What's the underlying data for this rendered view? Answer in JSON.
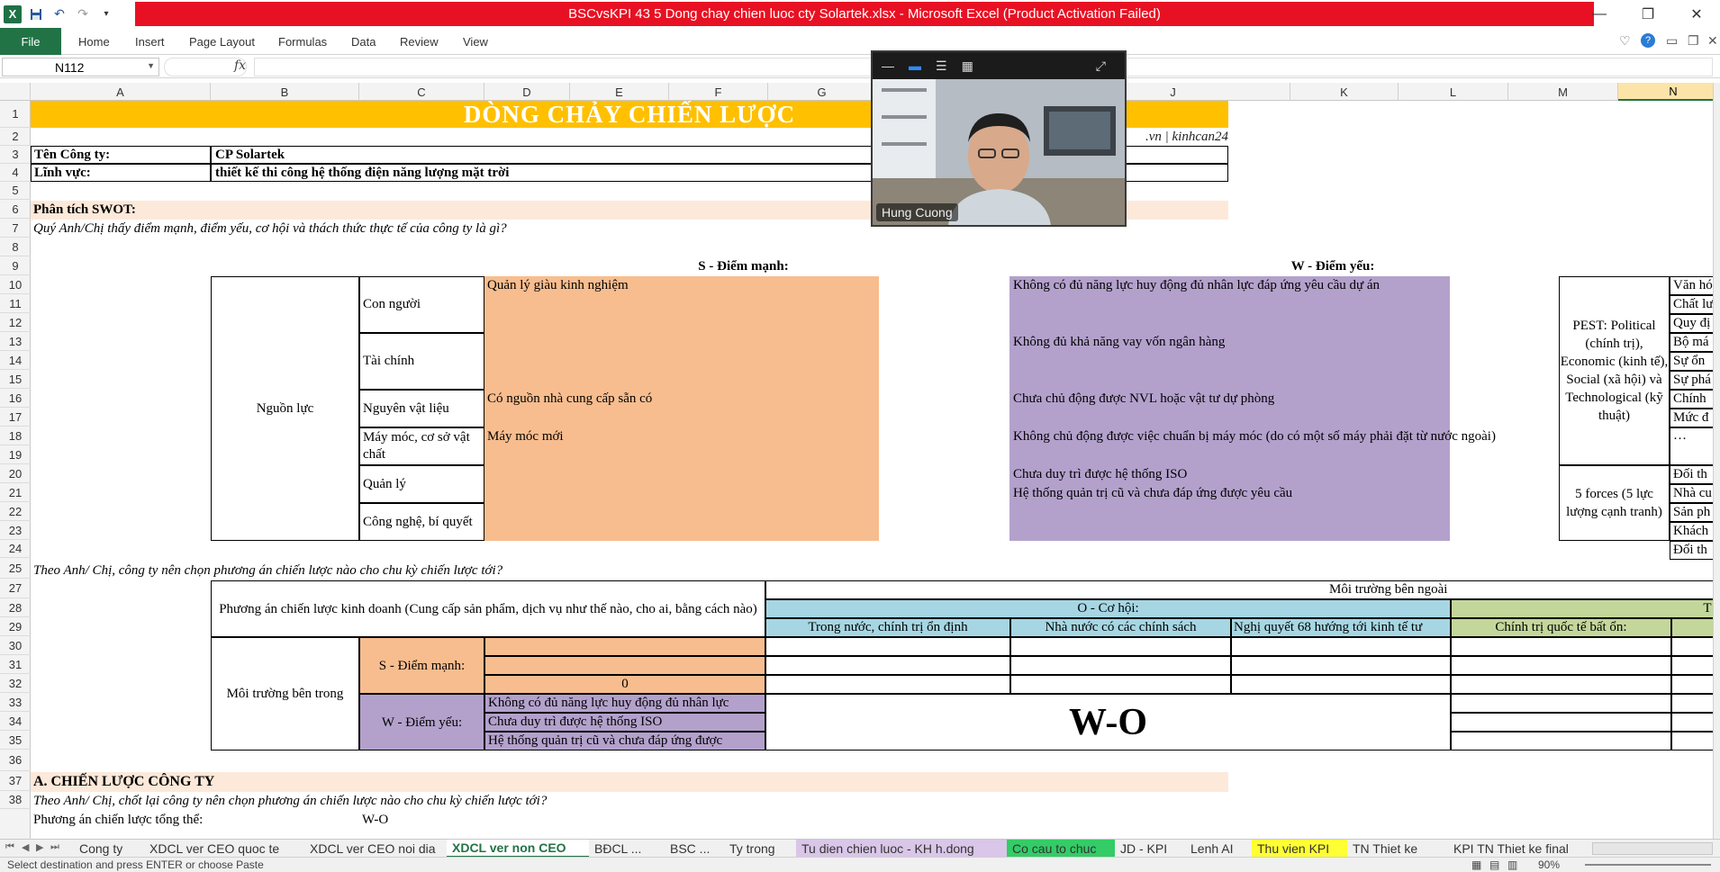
{
  "window": {
    "title": "BSCvsKPI 43 5 Dong chay chien luoc cty Solartek.xlsx  -  Microsoft Excel (Product Activation Failed)",
    "logo": "X"
  },
  "ribbon": {
    "file": "File",
    "tabs": [
      "Home",
      "Insert",
      "Page Layout",
      "Formulas",
      "Data",
      "Review",
      "View"
    ]
  },
  "formula_bar": {
    "name_box": "N112",
    "fx": "fx",
    "formula": ""
  },
  "columns": [
    "A",
    "B",
    "C",
    "D",
    "E",
    "F",
    "G",
    "H",
    "I",
    "J",
    "K",
    "L",
    "M",
    "N"
  ],
  "selected_column": "N",
  "rows": [
    "1",
    "2",
    "3",
    "4",
    "5",
    "6",
    "7",
    "8",
    "9",
    "10",
    "11",
    "12",
    "13",
    "14",
    "15",
    "16",
    "17",
    "18",
    "19",
    "20",
    "21",
    "22",
    "23",
    "24",
    "25",
    "27",
    "28",
    "29",
    "30",
    "31",
    "32",
    "33",
    "34",
    "35",
    "36",
    "37",
    "38"
  ],
  "sheet": {
    "title": "DÒNG CHẢY CHIẾN LƯỢC",
    "credit": ".vn | kinhcan24",
    "company_label": "Tên Công ty:",
    "company_value": "CP Solartek",
    "field_label": "Lĩnh vực:",
    "field_value": "thiết kế thi công hệ thống điện năng lượng mặt trời",
    "swot_heading": "Phân tích SWOT:",
    "swot_question": "Quý Anh/Chị thấy điểm mạnh, điểm yếu, cơ hội và thách thức thực tế của công ty là gì?",
    "s_header": "S - Điểm mạnh:",
    "w_header": "W - Điểm yếu:",
    "resources_label": "Nguồn lực",
    "resource_items": [
      "Con người",
      "Tài chính",
      "Nguyên vật liệu",
      "Máy móc, cơ sở vật chất",
      "Quản lý",
      "Công nghệ, bí quyết"
    ],
    "strengths": {
      "people": "Quản lý giàu kinh nghiệm",
      "materials": "Có nguồn nhà cung cấp sẵn có",
      "machines": "Máy móc mới"
    },
    "weaknesses": {
      "people": "Không có đủ năng lực huy động đủ nhân lực đáp ứng yêu cầu dự án",
      "finance": "Không đủ khả năng vay vốn ngân hàng",
      "materials": "Chưa chủ động được NVL hoặc vật tư dự phòng",
      "machines": "Không chủ động được việc chuẩn bị máy móc (do có một số máy phải đặt từ nước ngoài)",
      "management_1": "Chưa duy trì được hệ thống ISO",
      "management_2": "Hệ thống quản trị cũ và chưa đáp ứng được yêu cầu"
    },
    "pest_label": "PEST: Political (chính trị), Economic (kinh tế), Social (xã hội) và Technological (kỹ thuật)",
    "pest_items": [
      "Văn hó",
      "Chất lư",
      "Quy đị",
      "Bộ má",
      "Sự ổn",
      "Sự phá",
      "Chính",
      "Mức đ",
      "…"
    ],
    "forces_label": "5 forces (5 lực lượng cạnh tranh)",
    "forces_items": [
      "Đối th",
      "Nhà cu",
      "Sản ph",
      "Khách",
      "Đối th"
    ],
    "strategy_question": "Theo Anh/ Chị, công ty nên chọn phương án chiến lược nào cho chu kỳ chiến lược tới?",
    "strategy_option_label": "Phương án chiến lược kinh doanh (Cung cấp sản phẩm, dịch vụ như thế nào, cho ai, bằng cách nào)",
    "external_env": "Môi trường bên ngoài",
    "o_header": "O - Cơ hội:",
    "t_header": "T -",
    "opportunities": [
      "Trong nước, chính trị ổn định",
      "Nhà nước có các chính sách",
      "Nghị quyết 68 hướng tới kinh tế tư"
    ],
    "threats": [
      "Chính trị quốc tế bất ổn:"
    ],
    "internal_env": "Môi trường bên trong",
    "s_label_2": "S - Điểm mạnh:",
    "w_label_2": "W - Điểm yếu:",
    "zero_value": "0",
    "w_items_2": [
      "Không có đủ năng lực huy động đủ nhân lực",
      "Chưa duy trì được hệ thống ISO",
      "Hệ thống quản trị cũ và chưa đáp ứng được"
    ],
    "wo_label": "W-O",
    "section_a": "A. CHIẾN LƯỢC CÔNG TY",
    "final_question": "Theo Anh/ Chị, chốt lại công ty nên chọn phương án chiến lược nào cho chu kỳ chiến lược tới?",
    "overall_label": "Phương án chiến lược tổng thể:",
    "overall_value": "W-O"
  },
  "video": {
    "name": "Hung Cuong"
  },
  "sheet_tabs": [
    {
      "label": "Cong ty",
      "color": ""
    },
    {
      "label": "XDCL ver CEO quoc te",
      "color": ""
    },
    {
      "label": "XDCL ver CEO noi dia",
      "color": ""
    },
    {
      "label": "XDCL ver non CEO",
      "color": "active"
    },
    {
      "label": "BĐCL ...",
      "color": ""
    },
    {
      "label": "BSC ...",
      "color": ""
    },
    {
      "label": "Ty trong",
      "color": ""
    },
    {
      "label": "Tu dien chien luoc - KH h.dong",
      "color": "#d9c6e8"
    },
    {
      "label": "Co cau to chuc",
      "color": "#33cc66"
    },
    {
      "label": "JD - KPI",
      "color": ""
    },
    {
      "label": "Lenh AI",
      "color": ""
    },
    {
      "label": "Thu vien KPI",
      "color": "#ffff33"
    },
    {
      "label": "TN Thiet ke",
      "color": ""
    },
    {
      "label": "KPI TN Thiet ke final",
      "color": ""
    }
  ],
  "status": {
    "message": "Select destination and press ENTER or choose Paste",
    "zoom": "90%"
  },
  "colors": {
    "title_bar": "#e81123",
    "excel_green": "#217346",
    "strength": "#f8bd8e",
    "weakness": "#b3a1cc",
    "opportunity": "#a6d6e3",
    "threat": "#c4d79b",
    "title_fill": "#ffc000"
  }
}
